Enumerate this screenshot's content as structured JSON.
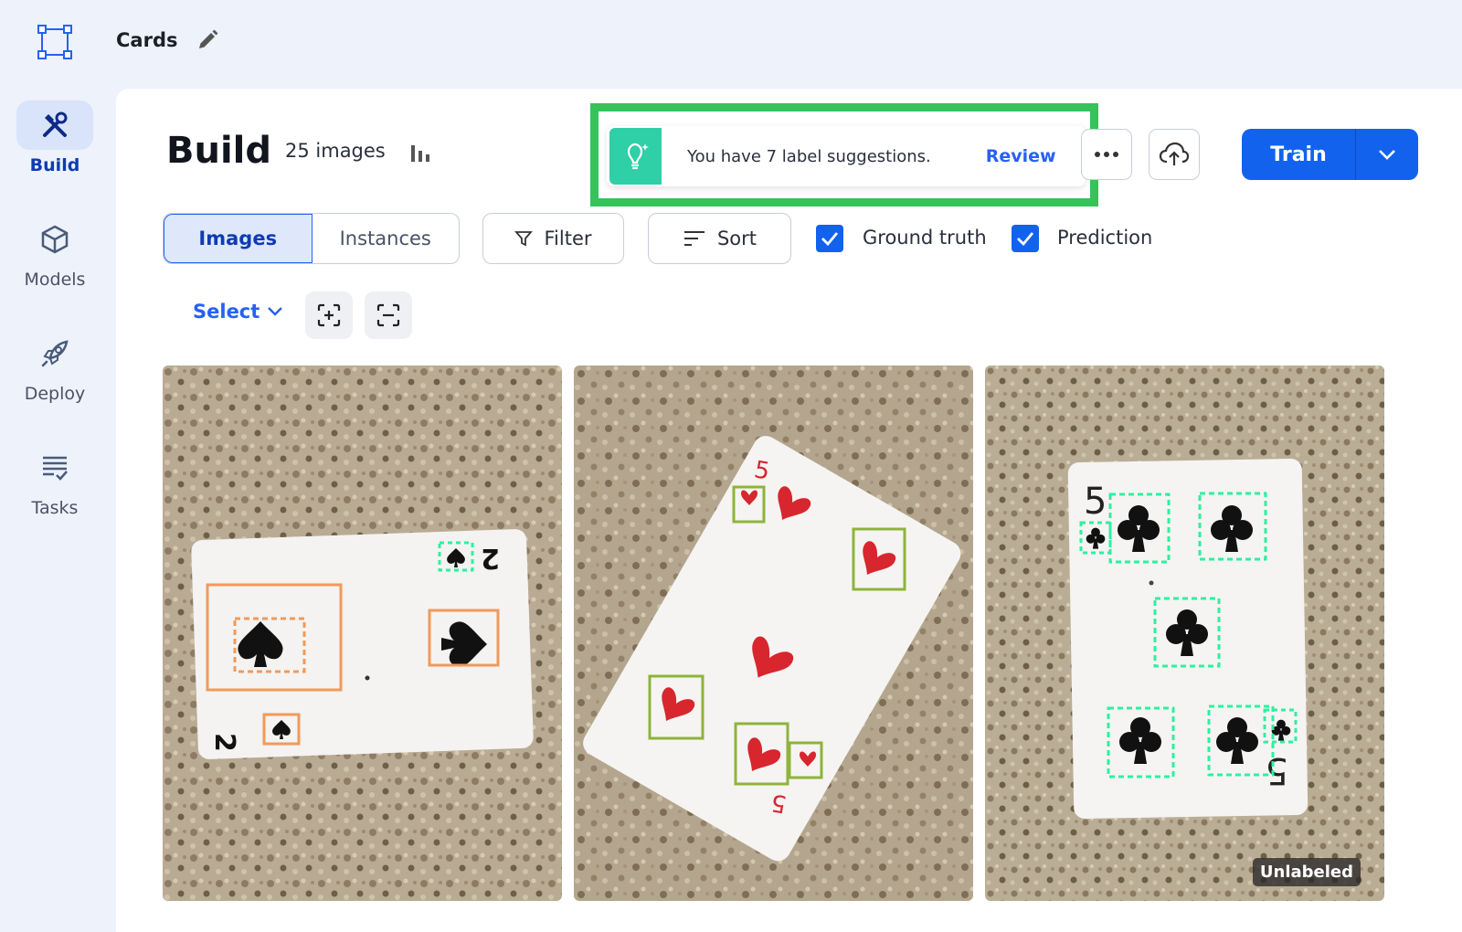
{
  "header": {
    "project_name": "Cards"
  },
  "sidebar": {
    "items": [
      {
        "label": "Build",
        "icon": "hammer-wrench-icon",
        "active": true
      },
      {
        "label": "Models",
        "icon": "cube-icon",
        "active": false
      },
      {
        "label": "Deploy",
        "icon": "rocket-icon",
        "active": false
      },
      {
        "label": "Tasks",
        "icon": "checklist-icon",
        "active": false
      }
    ]
  },
  "build": {
    "title": "Build",
    "image_count": "25 images"
  },
  "suggestion": {
    "text": "You have 7 label suggestions.",
    "action": "Review"
  },
  "toolbar": {
    "train_label": "Train",
    "view_tabs": [
      "Images",
      "Instances"
    ],
    "active_view": "Images",
    "filter_label": "Filter",
    "sort_label": "Sort",
    "ground_truth_label": "Ground truth",
    "ground_truth_checked": true,
    "prediction_label": "Prediction",
    "prediction_checked": true,
    "select_label": "Select"
  },
  "cards": [
    {
      "subject": "2 of spades",
      "annotation_color": "#f09a5a",
      "badge": ""
    },
    {
      "subject": "5 of hearts",
      "annotation_color": "#8fb33a",
      "badge": ""
    },
    {
      "subject": "5 of clubs",
      "annotation_color": "#2ef0a0",
      "badge": "Unlabeled"
    }
  ],
  "colors": {
    "accent": "#1262ee",
    "suggestion_highlight": "#36c35a",
    "suggestion_icon_bg": "#2fcfa8"
  }
}
